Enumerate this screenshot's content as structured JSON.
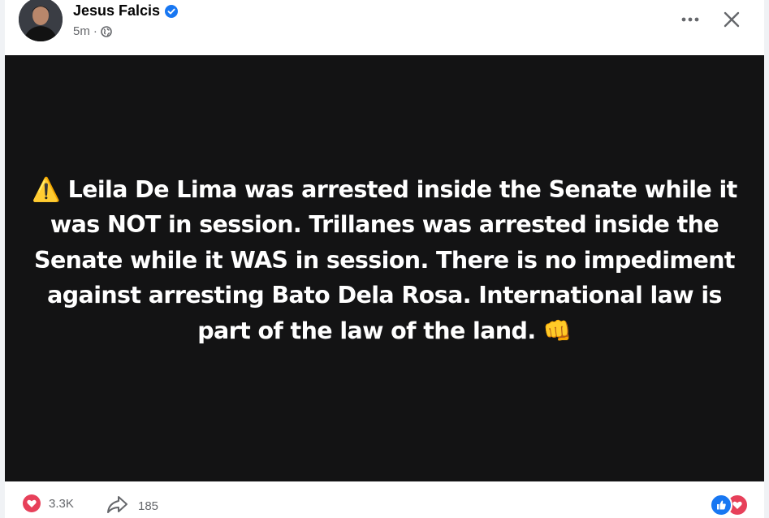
{
  "post": {
    "author": "Jesus Falcis",
    "time": "5m",
    "separator": "·",
    "body_text": "Leila De Lima was arrested inside the Senate while it was NOT in session. Trillanes was arrested inside the Senate while it WAS in session. There is no impediment against arresting Bato Dela Rosa. International law is part of the law of the land.",
    "warning_emoji": "⚠️",
    "fist_emoji": "👊",
    "background_color": "#131314",
    "text_color": "#ffffff"
  },
  "footer": {
    "reactions_count": "3.3K",
    "shares_count": "185"
  },
  "icons": {
    "verified": "verified-badge-icon",
    "privacy": "globe-icon",
    "more": "more-options-icon",
    "close": "close-icon",
    "love": "love-reaction-icon",
    "share": "share-icon",
    "like": "like-reaction-icon"
  },
  "colors": {
    "verified": "#1877f2",
    "love": "#e7405a",
    "like": "#1877f2"
  }
}
